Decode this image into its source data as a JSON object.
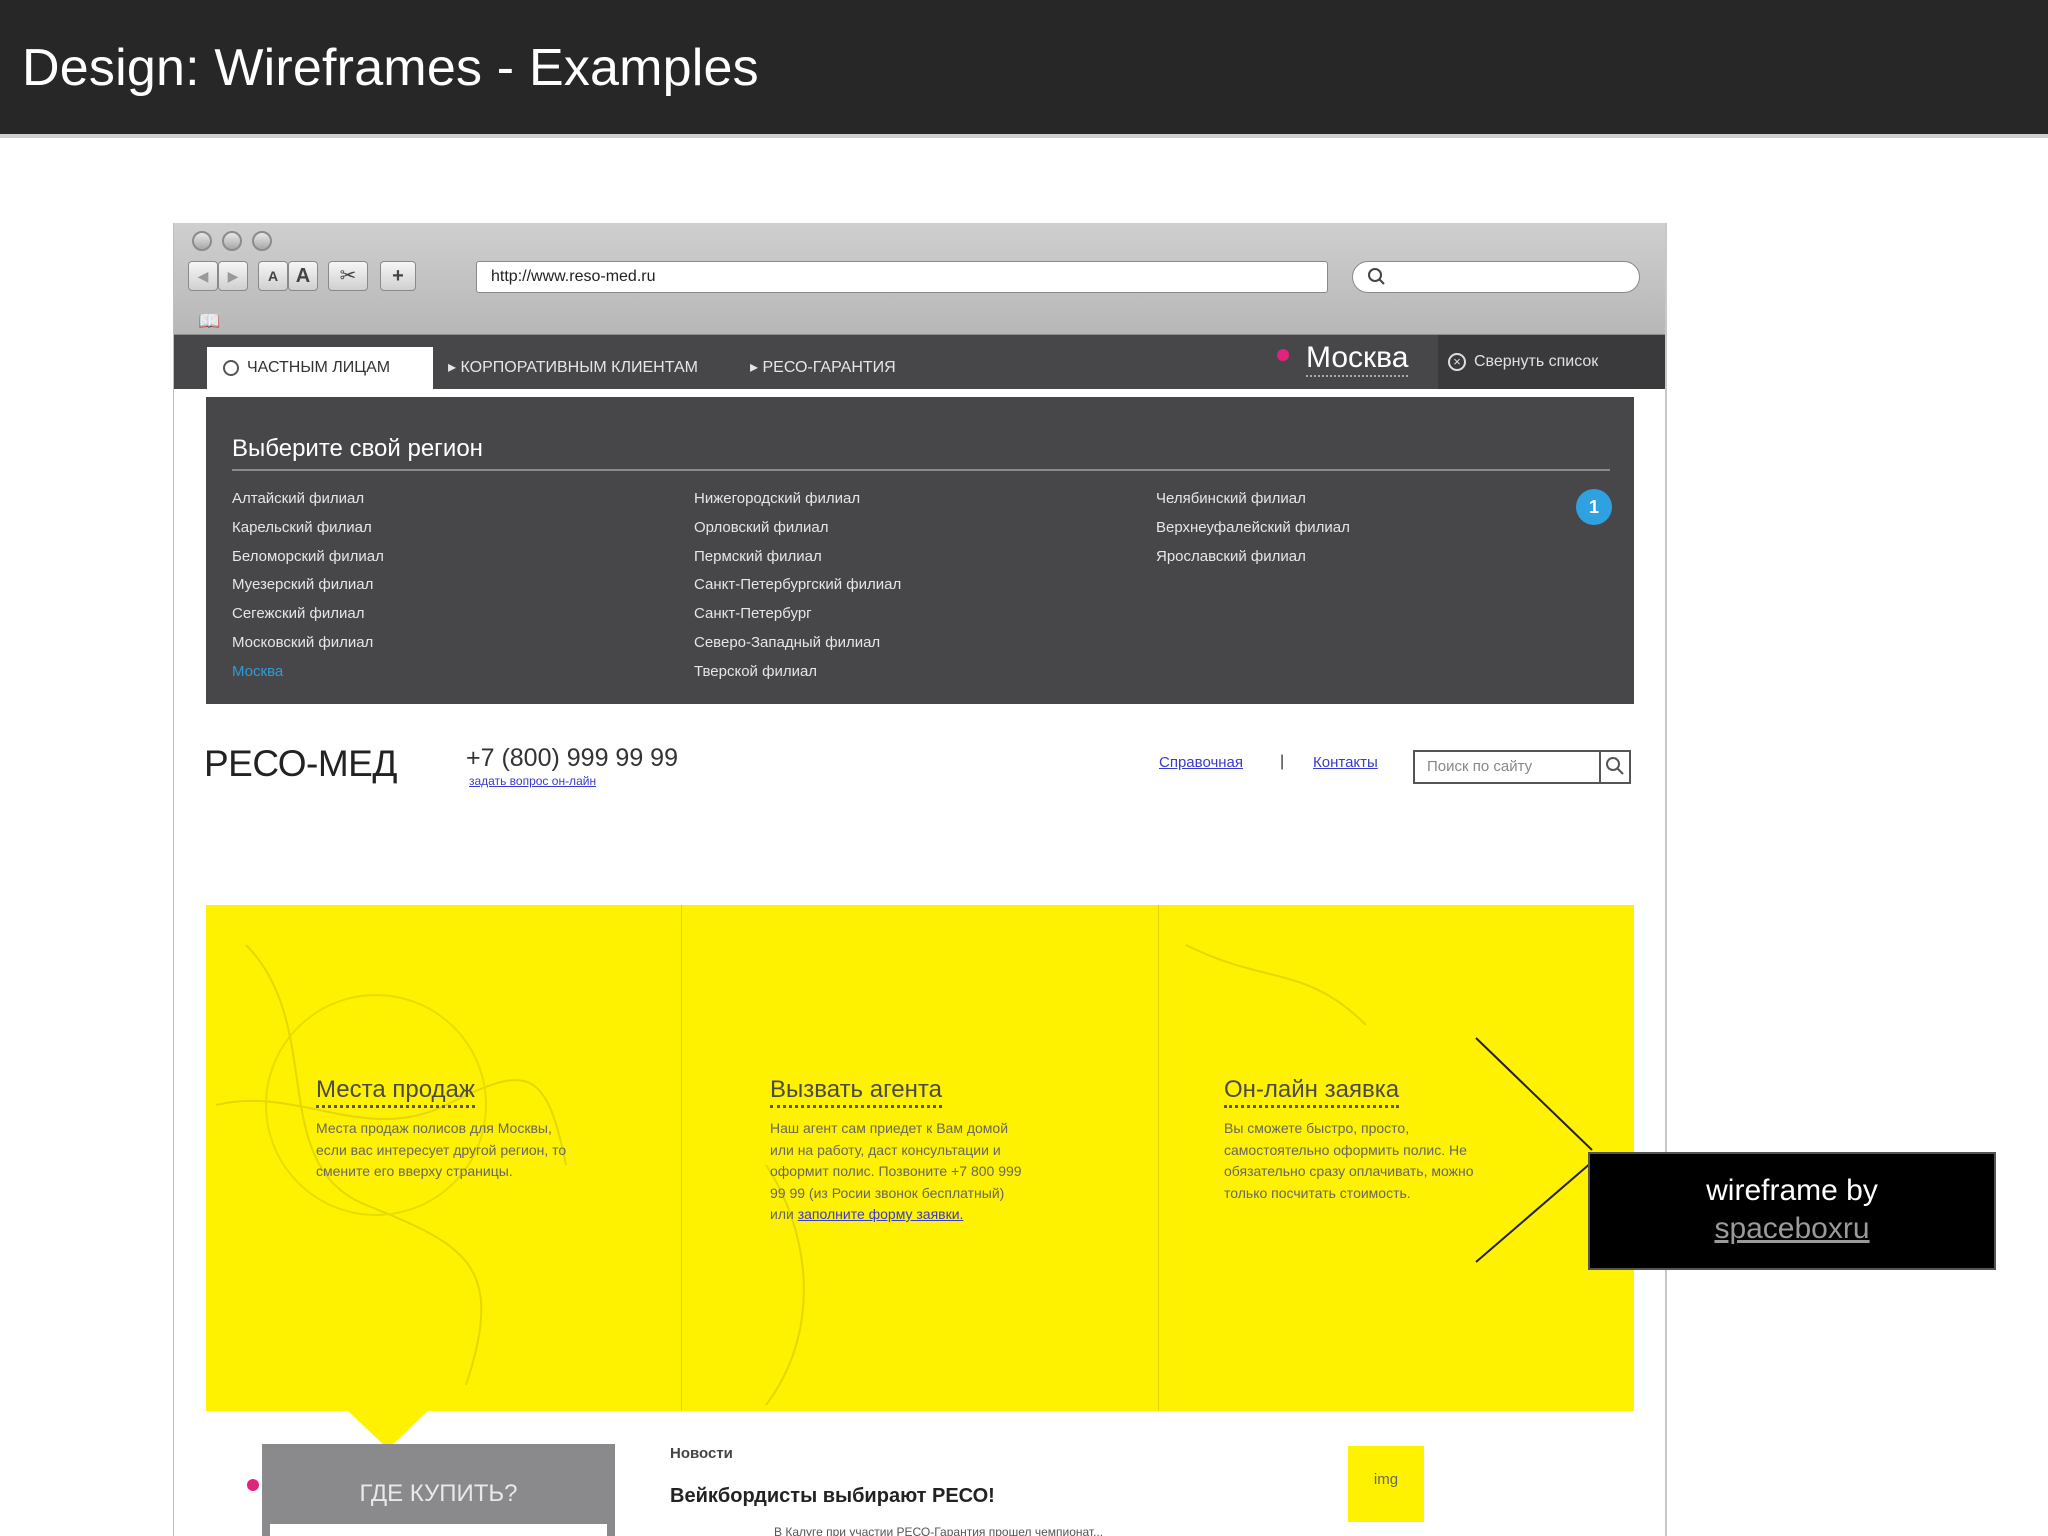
{
  "slide": {
    "title": "Design: Wireframes - Examples"
  },
  "browser": {
    "url": "http://www.reso-med.ru",
    "buttons": [
      "◀",
      "▶",
      "A",
      "A",
      "✂",
      "+"
    ]
  },
  "nav": {
    "active_tab": "ЧАСТНЫМ ЛИЦАМ",
    "tabs": [
      "КОРПОРАТИВНЫМ КЛИЕНТАМ",
      "РЕСО-ГАРАНТИЯ"
    ],
    "city": "Москва",
    "collapse": "Свернуть список"
  },
  "region": {
    "title": "Выберите свой регион",
    "badge": "1",
    "col1": [
      "Алтайский филиал",
      "Карельский филиал",
      "Беломорский филиал",
      "Муезерский филиал",
      "Сегежский филиал",
      "Московский филиал"
    ],
    "col1_active": "Москва",
    "col2": [
      "Нижегородский филиал",
      "Орловский филиал",
      "Пермский филиал",
      "Санкт-Петербургский филиал",
      "Санкт-Петербург",
      "Северо-Западный филиал",
      "Тверской филиал"
    ],
    "col3": [
      "Челябинский филиал",
      "Верхнеуфалейский филиал",
      "Ярославский филиал"
    ]
  },
  "header": {
    "brand": "РЕСО-МЕД",
    "phone": "+7 (800) 999 99 99",
    "ask": "задать вопрос он-лайн",
    "link1": "Справочная",
    "separator": "|",
    "link2": "Контакты",
    "search_placeholder": "Поиск по сайту"
  },
  "promo": {
    "col1": {
      "title": "Места продаж",
      "text": "Места продаж полисов для Москвы, если вас интересует другой регион, то смените его вверху страницы."
    },
    "col2": {
      "title": "Вызвать агента",
      "text": "Наш агент сам приедет к Вам домой или на работу, даст консультации и оформит полис. Позвоните +7 800 999 99 99 (из Росии звонок бесплатный) или",
      "link": "заполните форму заявки."
    },
    "col3": {
      "title": "Он-лайн заявка",
      "text": "Вы сможете быстро, просто, самостоятельно оформить полис. Не обязательно сразу оплачивать, можно только посчитать стоимость."
    }
  },
  "bottom": {
    "where_to_buy": "ГДЕ КУПИТЬ?",
    "news_label": "Новости",
    "news_title": "Вейкбордисты выбирают РЕСО!",
    "news_img": "img",
    "news_text": "В Калуге при участии РЕСО-Гарантия прошел чемпионат..."
  },
  "callout": {
    "text": "wireframe by",
    "link": "spaceboxru"
  },
  "colors": {
    "accent_yellow": "#fff200",
    "dark_gray": "#47474a",
    "link_blue": "#3a3acf",
    "badge_blue": "#2fa1e0",
    "pink": "#e0247c"
  }
}
